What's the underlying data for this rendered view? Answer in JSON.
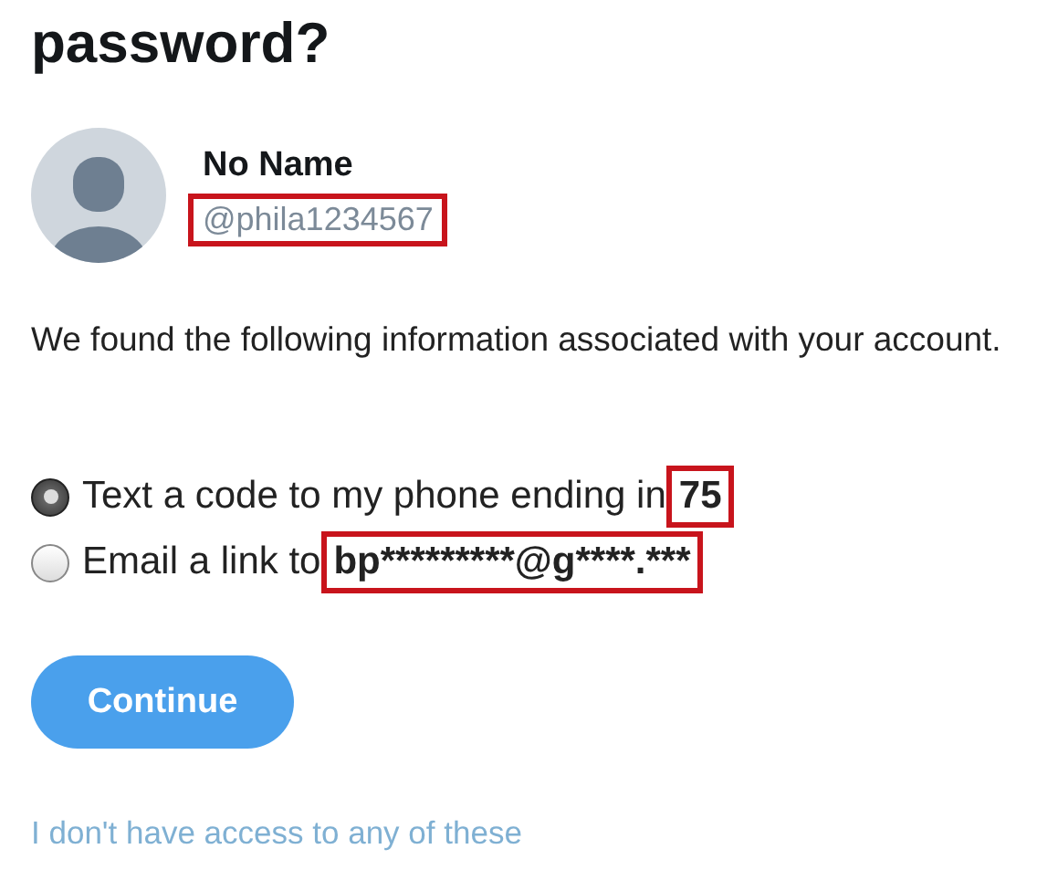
{
  "heading": "password?",
  "account": {
    "name": "No Name",
    "handle": "@phila1234567",
    "handle_highlighted": true
  },
  "message": "We found the following information associated with your account.",
  "options": [
    {
      "label": "Text a code to my phone ending in",
      "value": "75",
      "selected": true,
      "value_highlighted": true
    },
    {
      "label": "Email a link to",
      "value": "bp*********@g****.***",
      "selected": false,
      "value_highlighted": true
    }
  ],
  "continue_button": "Continue",
  "help_link": "I don't have access to any of these"
}
